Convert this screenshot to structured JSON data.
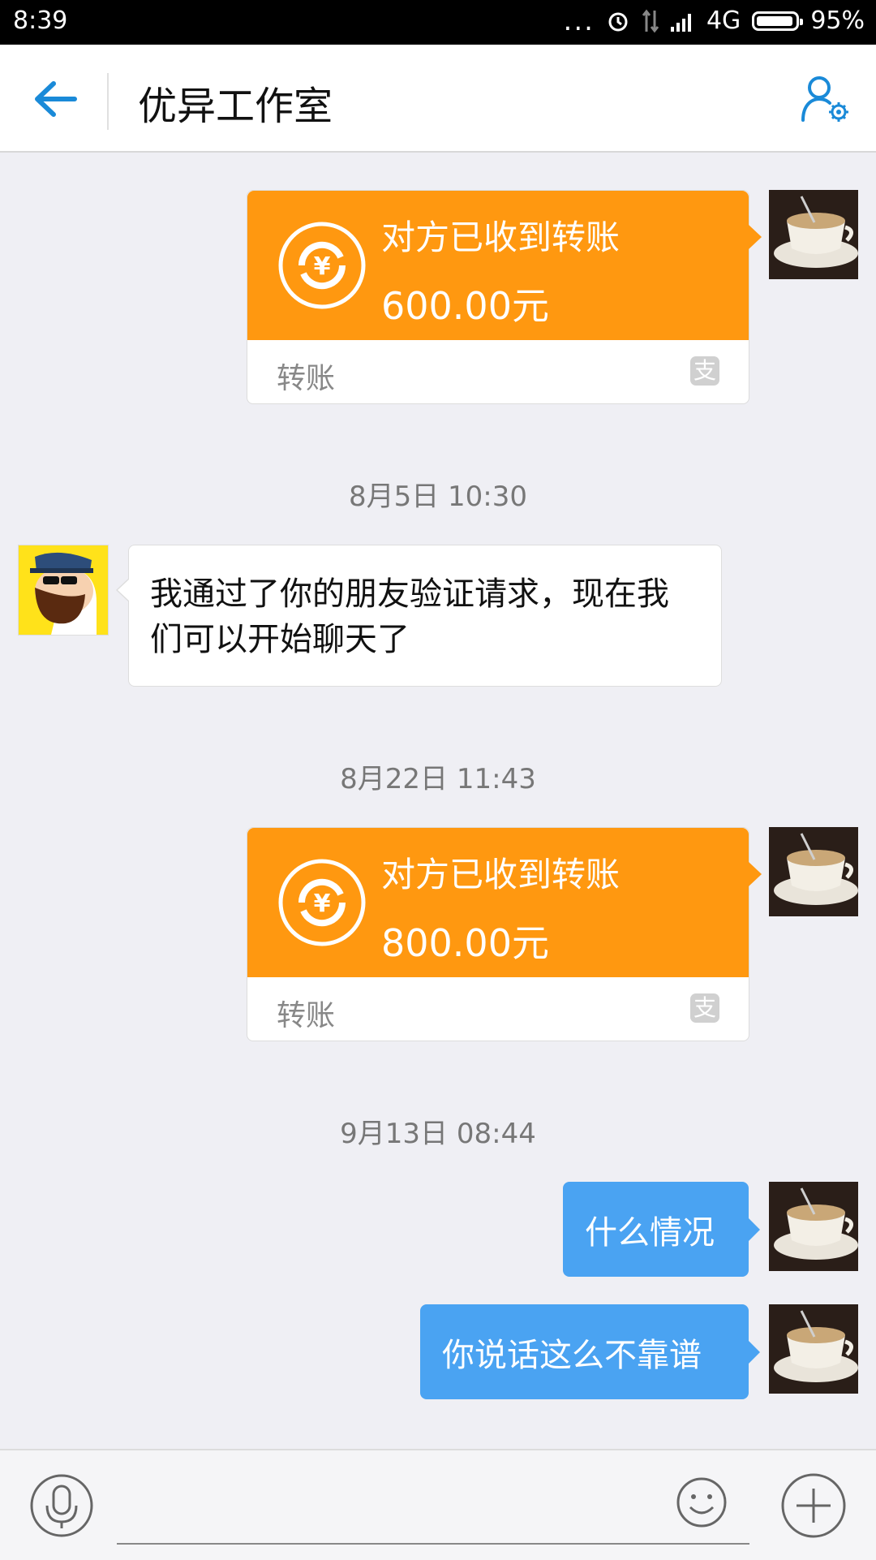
{
  "status_bar": {
    "time": "8:39",
    "dots": "...",
    "network": "4G",
    "battery": "95%",
    "battery_level": 0.95
  },
  "header": {
    "title": "优异工作室",
    "back_icon": "arrow-left-icon",
    "profile_icon": "person-settings-icon"
  },
  "messages": [
    {
      "type": "transfer",
      "status": "对方已收到转账",
      "amount": "600.00元",
      "label": "转账",
      "badge": "支"
    },
    {
      "type": "timestamp",
      "text": "8月5日 10:30"
    },
    {
      "type": "text-incoming",
      "text": "我通过了你的朋友验证请求，现在我们可以开始聊天了"
    },
    {
      "type": "timestamp",
      "text": "8月22日 11:43"
    },
    {
      "type": "transfer",
      "status": "对方已收到转账",
      "amount": "800.00元",
      "label": "转账",
      "badge": "支"
    },
    {
      "type": "timestamp",
      "text": "9月13日 08:44"
    },
    {
      "type": "text-outgoing",
      "text": "什么情况"
    },
    {
      "type": "text-outgoing",
      "text": "你说话这么不靠谱"
    }
  ],
  "input_bar": {
    "mic_icon": "microphone-icon",
    "emoji_icon": "smiley-icon",
    "plus_icon": "plus-icon"
  },
  "colors": {
    "transfer_orange": "#ff9810",
    "bubble_blue": "#4aa3f2",
    "accent_blue": "#1a8ad8"
  }
}
